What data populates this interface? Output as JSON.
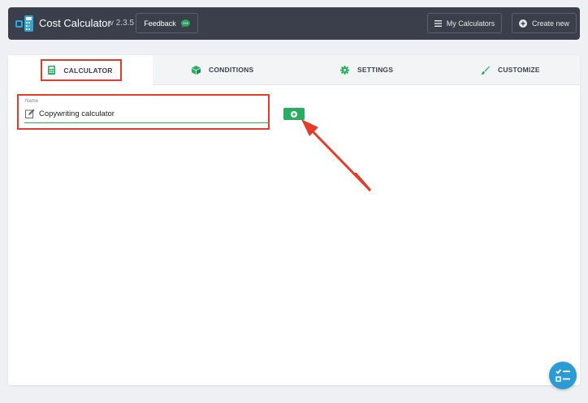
{
  "header": {
    "app_title": "Cost Calculator",
    "version": "v 2.3.5",
    "feedback_label": "Feedback",
    "my_calculators_label": "My Calculators",
    "create_new_label": "Create new"
  },
  "tabs": [
    {
      "label": "CALCULATOR",
      "icon": "calculator-icon",
      "active": true
    },
    {
      "label": "CONDITIONS",
      "icon": "cube-icon",
      "active": false
    },
    {
      "label": "SETTINGS",
      "icon": "gear-icon",
      "active": false
    },
    {
      "label": "CUSTOMIZE",
      "icon": "brush-icon",
      "active": false
    }
  ],
  "name_field": {
    "label": "Name",
    "value": "Copywriting calculator"
  },
  "colors": {
    "header_bg": "#3a3f4b",
    "accent_green": "#27ae60",
    "highlight_red": "#e53b2a",
    "fab_blue": "#2b9bd6"
  }
}
